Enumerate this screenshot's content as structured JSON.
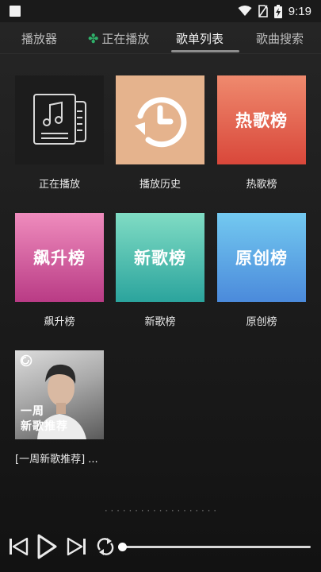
{
  "status": {
    "time": "9:19"
  },
  "tabs": [
    {
      "label": "播放器",
      "active": false
    },
    {
      "label": "正在播放",
      "active": false,
      "icon": "clover-icon"
    },
    {
      "label": "歌单列表",
      "active": true
    },
    {
      "label": "歌曲搜索",
      "active": false
    }
  ],
  "tiles": [
    {
      "label": "正在播放",
      "cover_text": "",
      "icon": "music-note-document-icon",
      "color_top": "#1b1b1b",
      "color_bottom": "#1b1b1b"
    },
    {
      "label": "播放历史",
      "cover_text": "",
      "icon": "history-clock-icon",
      "color_top": "#e8b48d",
      "color_bottom": "#e0ac87"
    },
    {
      "label": "热歌榜",
      "cover_text": "热歌榜",
      "color_top": "#f0886d",
      "color_bottom": "#d94b3a"
    },
    {
      "label": "飙升榜",
      "cover_text": "飙升榜",
      "color_top": "#ef8bbd",
      "color_bottom": "#bb3d86"
    },
    {
      "label": "新歌榜",
      "cover_text": "新歌榜",
      "color_top": "#7edbc3",
      "color_bottom": "#2ca79e"
    },
    {
      "label": "原创榜",
      "cover_text": "原创榜",
      "color_top": "#74c8ef",
      "color_bottom": "#4d8fdc"
    },
    {
      "label": "[一周新歌推荐] ...",
      "cover_text": "一周\n新歌推荐",
      "icon": "netease-logo-icon",
      "color_top": "#c9c9c9",
      "color_bottom": "#4a4a4a"
    }
  ],
  "player": {
    "progress": 0
  }
}
